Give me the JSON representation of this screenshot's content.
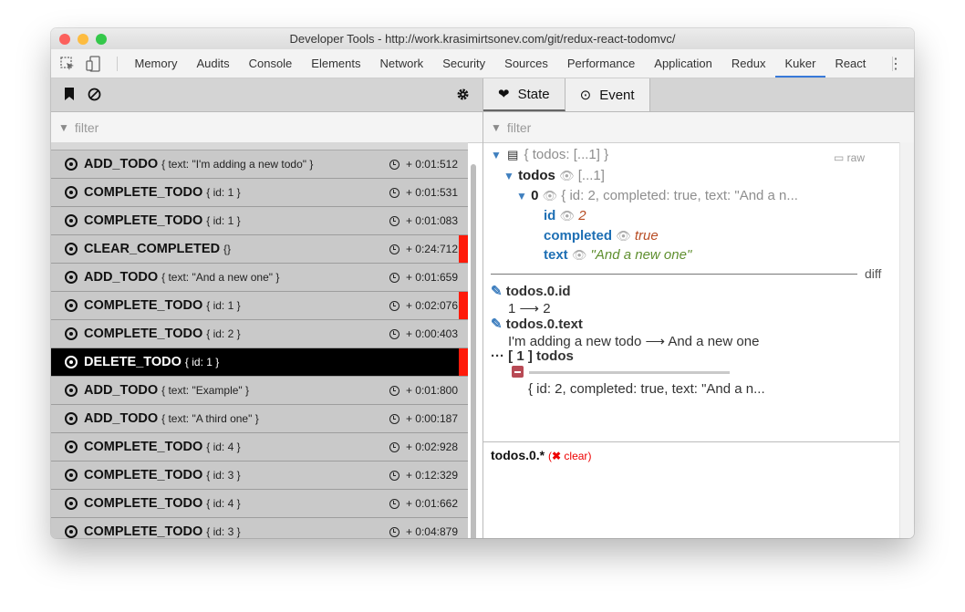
{
  "window": {
    "title": "Developer Tools - http://work.krasimirtsonev.com/git/redux-react-todomvc/",
    "traffic_colors": [
      "#fc605c",
      "#fdbc40",
      "#34c84a"
    ]
  },
  "devtools_tabs": [
    "Memory",
    "Audits",
    "Console",
    "Elements",
    "Network",
    "Security",
    "Sources",
    "Performance",
    "Application",
    "Redux",
    "Kuker",
    "React"
  ],
  "active_tab": "Kuker",
  "left": {
    "filter_placeholder": "filter",
    "events": [
      {
        "type": "ADD_TODO",
        "payload": "{ text: \"I'm adding a new todo\" }",
        "time": "+ 0:01:512",
        "marker": false,
        "selected": false
      },
      {
        "type": "COMPLETE_TODO",
        "payload": "{ id: 1 }",
        "time": "+ 0:01:531",
        "marker": false,
        "selected": false
      },
      {
        "type": "COMPLETE_TODO",
        "payload": "{ id: 1 }",
        "time": "+ 0:01:083",
        "marker": false,
        "selected": false
      },
      {
        "type": "CLEAR_COMPLETED",
        "payload": "{}",
        "time": "+ 0:24:712",
        "marker": true,
        "selected": false
      },
      {
        "type": "ADD_TODO",
        "payload": "{ text: \"And a new one\" }",
        "time": "+ 0:01:659",
        "marker": false,
        "selected": false
      },
      {
        "type": "COMPLETE_TODO",
        "payload": "{ id: 1 }",
        "time": "+ 0:02:076",
        "marker": true,
        "selected": false
      },
      {
        "type": "COMPLETE_TODO",
        "payload": "{ id: 2 }",
        "time": "+ 0:00:403",
        "marker": false,
        "selected": false
      },
      {
        "type": "DELETE_TODO",
        "payload": "{ id: 1 }",
        "time": "",
        "marker": true,
        "selected": true
      },
      {
        "type": "ADD_TODO",
        "payload": "{ text: \"Example\" }",
        "time": "+ 0:01:800",
        "marker": false,
        "selected": false
      },
      {
        "type": "ADD_TODO",
        "payload": "{ text: \"A third one\" }",
        "time": "+ 0:00:187",
        "marker": false,
        "selected": false
      },
      {
        "type": "COMPLETE_TODO",
        "payload": "{ id: 4 }",
        "time": "+ 0:02:928",
        "marker": false,
        "selected": false
      },
      {
        "type": "COMPLETE_TODO",
        "payload": "{ id: 3 }",
        "time": "+ 0:12:329",
        "marker": false,
        "selected": false
      },
      {
        "type": "COMPLETE_TODO",
        "payload": "{ id: 4 }",
        "time": "+ 0:01:662",
        "marker": false,
        "selected": false
      },
      {
        "type": "COMPLETE_TODO",
        "payload": "{ id: 3 }",
        "time": "+ 0:04:879",
        "marker": false,
        "selected": false
      }
    ]
  },
  "right": {
    "tab_state": "State",
    "tab_event": "Event",
    "filter_placeholder": "filter",
    "raw_label": "raw",
    "tree": {
      "root_summary": "{ todos: [...1] }",
      "todos_key": "todos",
      "todos_summary": "[...1]",
      "item_index": "0",
      "item_summary": "{ id: 2, completed: true, text: \"And a n...",
      "id_key": "id",
      "id_value": "2",
      "completed_key": "completed",
      "completed_value": "true",
      "text_key": "text",
      "text_value": "\"And a new one\""
    },
    "diff": {
      "label": "diff",
      "change1_path": "todos.0.id",
      "change1_from": "1",
      "change1_to": "2",
      "change2_path": "todos.0.text",
      "change2_from": "I'm adding a new todo",
      "change2_to": "And a new one",
      "removed_header": "[ 1 ] todos",
      "removed_value": "{ id: 2, completed: true, text: \"And a n..."
    },
    "bottom_path": "todos.0.*",
    "clear_label": "clear"
  }
}
